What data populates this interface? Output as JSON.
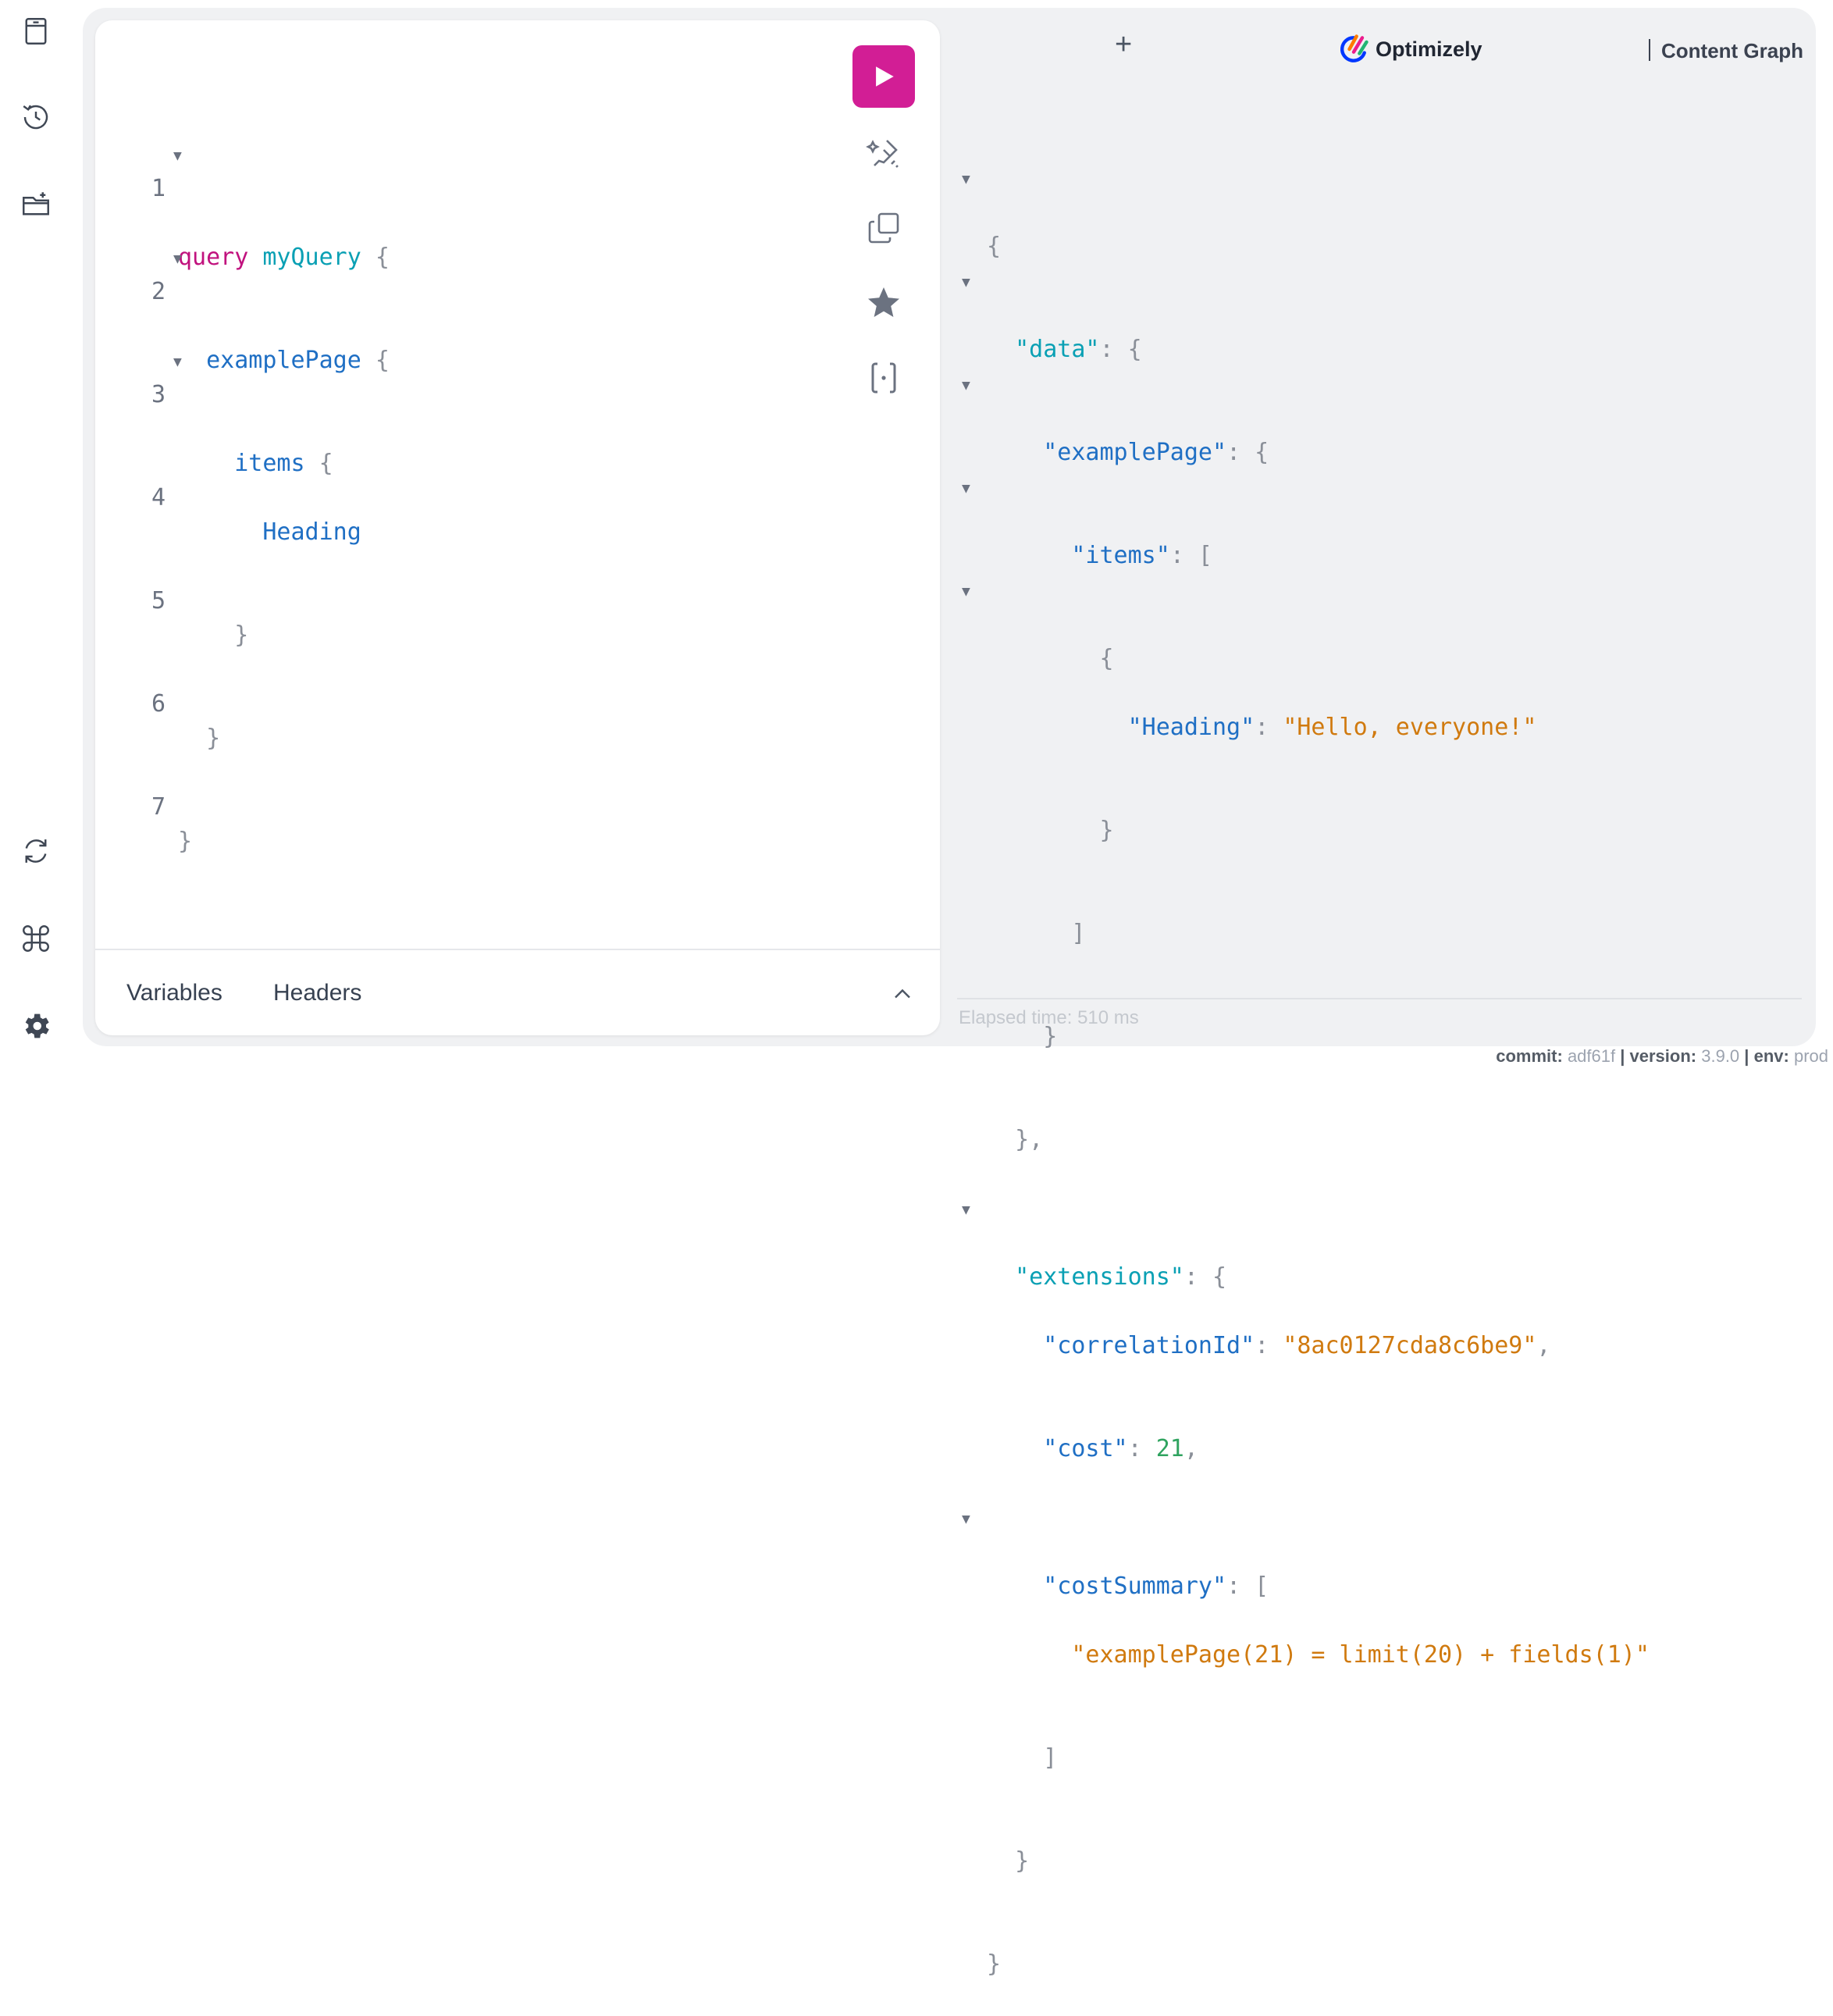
{
  "sidebar": {
    "top_icons": [
      "docs-icon",
      "history-icon",
      "folder-add-icon"
    ],
    "bottom_icons": [
      "refetch-icon",
      "shortcuts-icon",
      "settings-icon"
    ]
  },
  "editor": {
    "lines": [
      {
        "n": "1",
        "fold": true
      },
      {
        "n": "2",
        "fold": true
      },
      {
        "n": "3",
        "fold": true
      },
      {
        "n": "4",
        "fold": false
      },
      {
        "n": "5",
        "fold": false
      },
      {
        "n": "6",
        "fold": false
      },
      {
        "n": "7",
        "fold": false
      }
    ],
    "tokens": {
      "l1_kw": "query",
      "l1_name": "myQuery",
      "l1_brace": "{",
      "l2_field": "examplePage",
      "l2_brace": "{",
      "l3_field": "items",
      "l3_brace": "{",
      "l4_field": "Heading",
      "l5": "}",
      "l6": "}",
      "l7": "}"
    },
    "fold_glyph": "▼",
    "bottom_tabs": {
      "variables": "Variables",
      "headers": "Headers"
    }
  },
  "toolbar": {
    "run": "run-icon",
    "prettify": "prettify-icon",
    "copy": "copy-icon",
    "favorite": "star-icon",
    "merge": "merge-fragments-icon"
  },
  "header": {
    "plus": "+",
    "logo_text": "Optimizely",
    "content_graph": "Content Graph"
  },
  "result": {
    "l1": "{",
    "l2_key": "\"data\"",
    "l2_rest": ": {",
    "l3_key": "\"examplePage\"",
    "l3_rest": ": {",
    "l4_key": "\"items\"",
    "l4_rest": ": [",
    "l5": "{",
    "l6_key": "\"Heading\"",
    "l6_colon": ": ",
    "l6_val": "\"Hello, everyone!\"",
    "l7": "}",
    "l8": "]",
    "l9": "}",
    "l10": "},",
    "l11_key": "\"extensions\"",
    "l11_rest": ": {",
    "l12_key": "\"correlationId\"",
    "l12_colon": ": ",
    "l12_val": "\"8ac0127cda8c6be9\"",
    "l12_comma": ",",
    "l13_key": "\"cost\"",
    "l13_colon": ": ",
    "l13_val": "21",
    "l13_comma": ",",
    "l14_key": "\"costSummary\"",
    "l14_rest": ": [",
    "l15_val": "\"examplePage(21) = limit(20) + fields(1)\"",
    "l16": "]",
    "l17": "}",
    "l18": "}"
  },
  "elapsed": "Elapsed time: 510 ms",
  "footer": {
    "commit_label": "commit:",
    "commit": "adf61f",
    "sep1": "|",
    "version_label": "version:",
    "version": "3.9.0",
    "sep2": "|",
    "env_label": "env:",
    "env": "prod"
  },
  "colors": {
    "run_button": "#d21e95",
    "keyword": "#c1127e",
    "field": "#1f6fc4",
    "string": "#d07a0f",
    "number": "#2fa35f"
  }
}
